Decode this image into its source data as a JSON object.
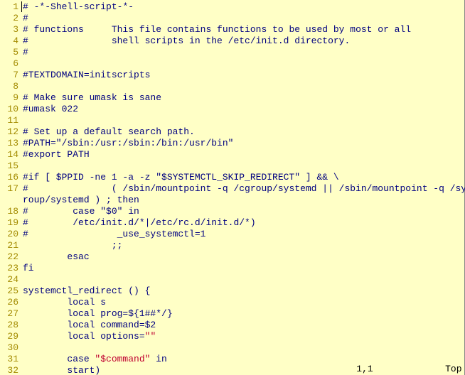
{
  "lines": [
    {
      "num": "1",
      "segments": [
        {
          "t": "# ",
          "isCursor": true
        },
        {
          "t": "-*-Shell-script-*-"
        }
      ]
    },
    {
      "num": "2",
      "segments": [
        {
          "t": "#"
        }
      ]
    },
    {
      "num": "3",
      "segments": [
        {
          "t": "# functions     This file contains functions to be used by most or all"
        }
      ]
    },
    {
      "num": "4",
      "segments": [
        {
          "t": "#               shell scripts in the /etc/init.d directory."
        }
      ]
    },
    {
      "num": "5",
      "segments": [
        {
          "t": "#"
        }
      ]
    },
    {
      "num": "6",
      "segments": []
    },
    {
      "num": "7",
      "segments": [
        {
          "t": "#TEXTDOMAIN=initscripts"
        }
      ]
    },
    {
      "num": "8",
      "segments": []
    },
    {
      "num": "9",
      "segments": [
        {
          "t": "# Make sure umask is sane"
        }
      ]
    },
    {
      "num": "10",
      "segments": [
        {
          "t": "#umask 022"
        }
      ]
    },
    {
      "num": "11",
      "segments": []
    },
    {
      "num": "12",
      "segments": [
        {
          "t": "# Set up a default search path."
        }
      ]
    },
    {
      "num": "13",
      "segments": [
        {
          "t": "#PATH=\"/sbin:/usr:/sbin:/bin:/usr/bin\""
        }
      ]
    },
    {
      "num": "14",
      "segments": [
        {
          "t": "#export PATH"
        }
      ]
    },
    {
      "num": "15",
      "segments": []
    },
    {
      "num": "16",
      "segments": [
        {
          "t": "#if [ $PPID -ne 1 -a -z \"$SYSTEMCTL_SKIP_REDIRECT\" ] && \\"
        }
      ]
    },
    {
      "num": "17",
      "segments": [
        {
          "t": "#               ( /sbin/mountpoint -q /cgroup/systemd || /sbin/mountpoint -q /sys/fs/cg"
        }
      ]
    },
    {
      "num": "",
      "segments": [
        {
          "t": "roup/systemd ) ; then"
        }
      ],
      "wrapIndent": "    "
    },
    {
      "num": "18",
      "segments": [
        {
          "t": "#        case \"$0\" in"
        }
      ]
    },
    {
      "num": "19",
      "segments": [
        {
          "t": "#        /etc/init.d/*|/etc/rc.d/init.d/*)"
        }
      ]
    },
    {
      "num": "20",
      "segments": [
        {
          "t": "#                _use_systemctl=1"
        }
      ]
    },
    {
      "num": "21",
      "segments": [
        {
          "t": "                ;;"
        }
      ]
    },
    {
      "num": "22",
      "segments": [
        {
          "t": "        esac"
        }
      ]
    },
    {
      "num": "23",
      "segments": [
        {
          "t": "fi"
        }
      ]
    },
    {
      "num": "24",
      "segments": []
    },
    {
      "num": "25",
      "segments": [
        {
          "t": "systemctl_redirect () {"
        }
      ]
    },
    {
      "num": "26",
      "segments": [
        {
          "t": "        local s"
        }
      ]
    },
    {
      "num": "27",
      "segments": [
        {
          "t": "        local prog=${1##*/}"
        }
      ]
    },
    {
      "num": "28",
      "segments": [
        {
          "t": "        local command=$2"
        }
      ]
    },
    {
      "num": "29",
      "segments": [
        {
          "t": "        local options="
        },
        {
          "t": "\"\"",
          "cls": "string"
        }
      ]
    },
    {
      "num": "30",
      "segments": []
    },
    {
      "num": "31",
      "segments": [
        {
          "t": "        case "
        },
        {
          "t": "\"$command\"",
          "cls": "string"
        },
        {
          "t": " in"
        }
      ]
    },
    {
      "num": "32",
      "segments": [
        {
          "t": "        start)"
        }
      ]
    }
  ],
  "status": {
    "position": "1,1",
    "mode": "Top"
  }
}
